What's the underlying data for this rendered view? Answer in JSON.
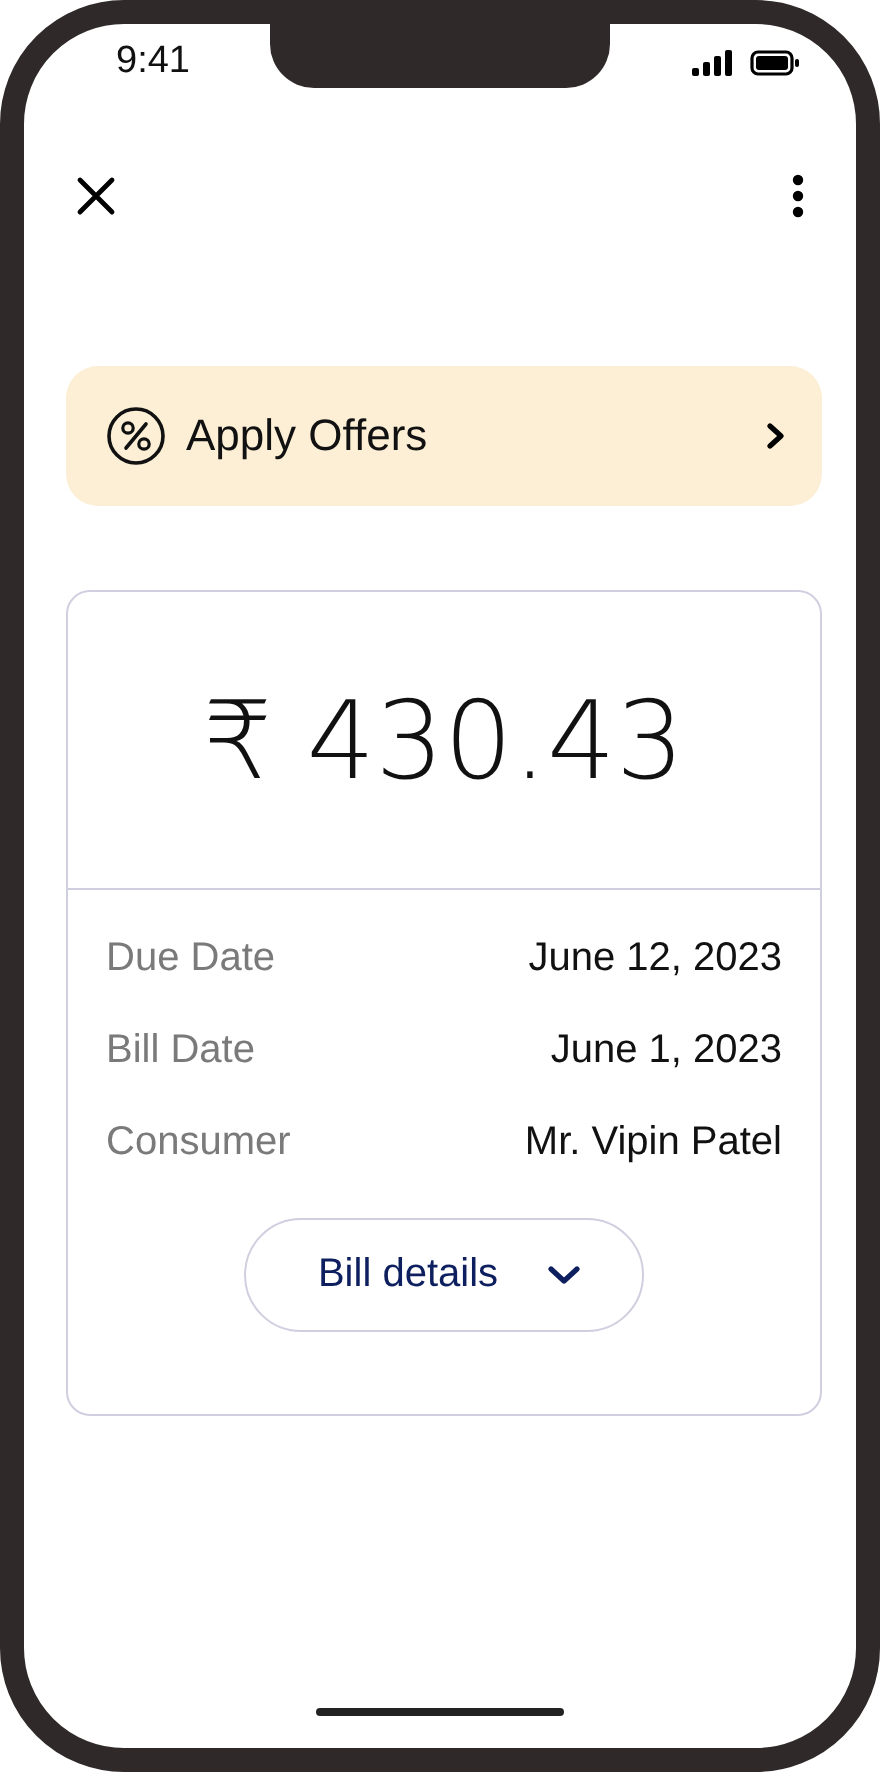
{
  "status_bar": {
    "time": "9:41"
  },
  "offers": {
    "label": "Apply Offers"
  },
  "bill": {
    "amount": "₹ 430.43",
    "details": [
      {
        "label": "Due Date",
        "value": "June 12, 2023"
      },
      {
        "label": "Bill Date",
        "value": "June 1, 2023"
      },
      {
        "label": "Consumer",
        "value": "Mr. Vipin Patel"
      }
    ],
    "button": {
      "label": "Bill details"
    }
  }
}
